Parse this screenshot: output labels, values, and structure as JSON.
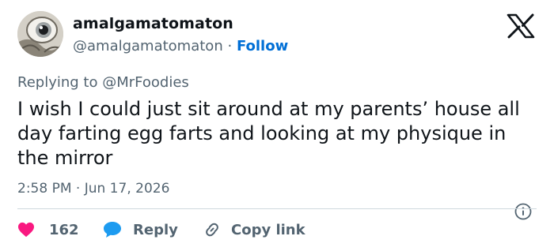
{
  "author": {
    "display_name": "amalgamatomaton",
    "handle": "@amalgamatomaton",
    "separator": "·",
    "follow_label": "Follow"
  },
  "brand": {
    "logo_icon": "x-logo-icon"
  },
  "reply_context": {
    "prefix": "Replying to",
    "mention": "@MrFoodies"
  },
  "tweet": {
    "text": "I wish I could just sit around at my parents’ house all day farting egg farts and looking at my physique in the mirror",
    "time": "2:58 PM",
    "separator": "·",
    "date": "Jun 17, 2026",
    "info_icon": "info-icon"
  },
  "actions": {
    "like": {
      "icon": "heart-icon",
      "count": "162"
    },
    "reply": {
      "icon": "speech-bubble-icon",
      "label": "Reply"
    },
    "copy_link": {
      "icon": "link-icon",
      "label": "Copy link"
    }
  },
  "colors": {
    "text": "#0f1419",
    "secondary": "#536471",
    "link": "#006fd6",
    "like": "#f91880",
    "reply": "#1d9bf0",
    "divider": "#cfd9de"
  }
}
